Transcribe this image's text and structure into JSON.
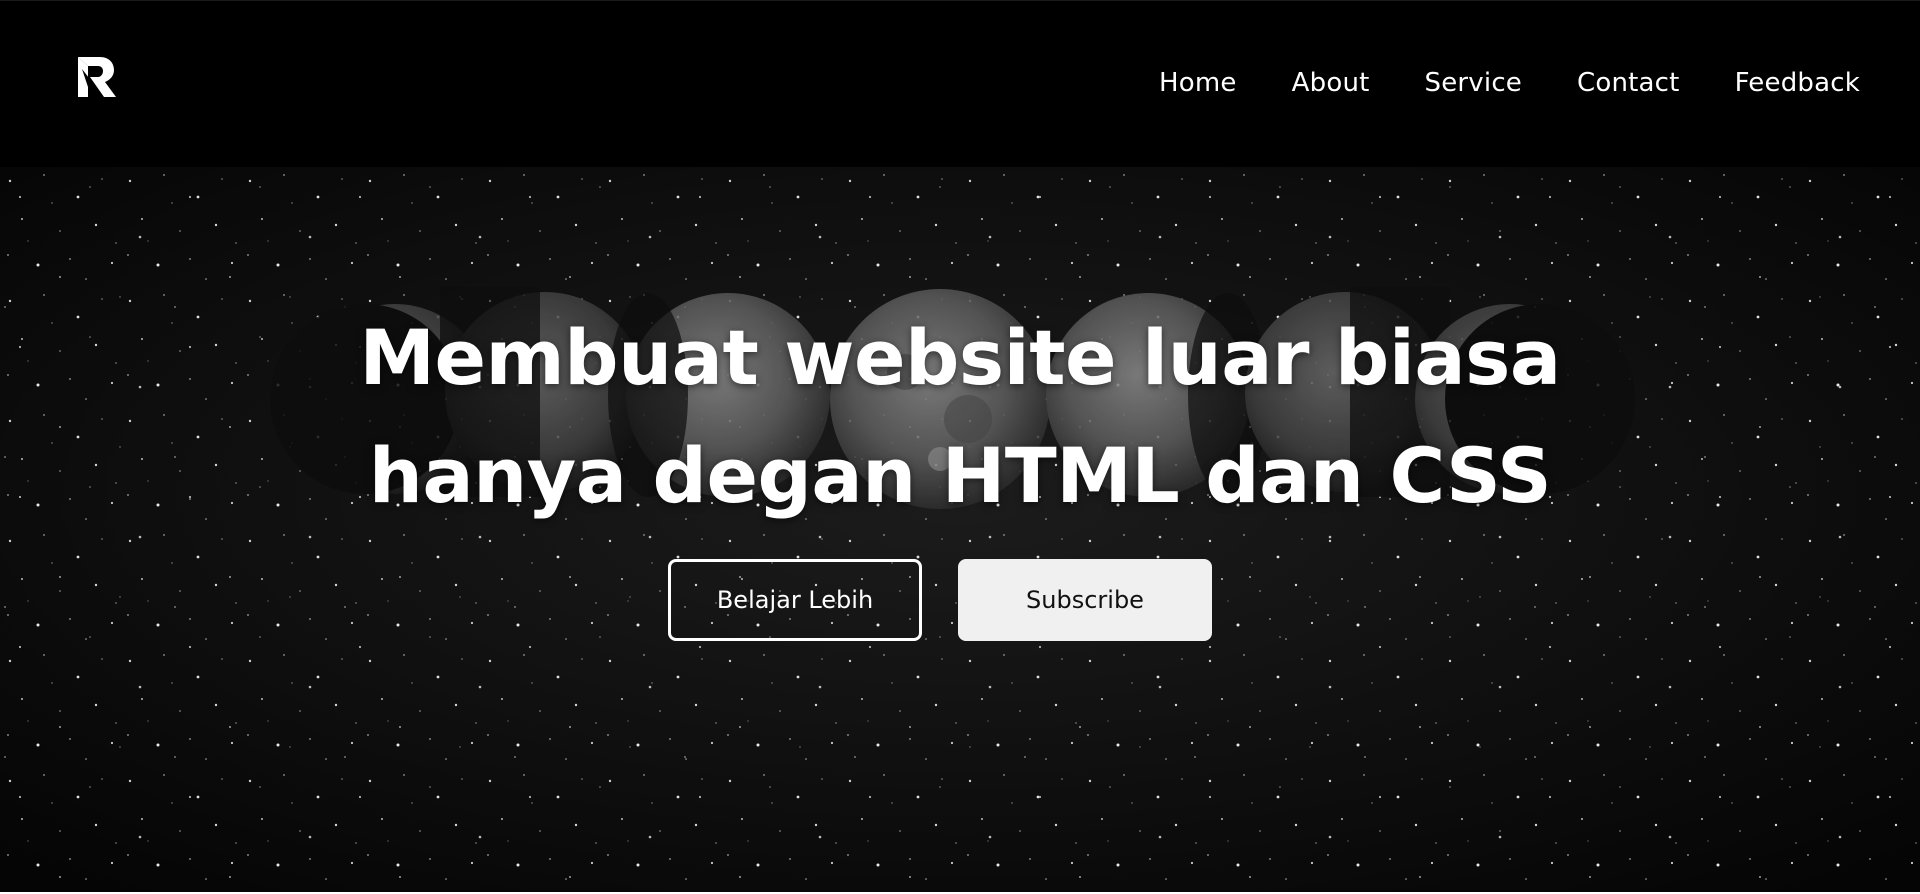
{
  "colors": {
    "navbar_bg": "#000000",
    "hero_bg": "#0a0a0a",
    "text": "#ffffff",
    "button_solid_bg": "#f0f0f0",
    "button_solid_text": "#111111"
  },
  "logo": {
    "icon": "r-logo-icon"
  },
  "nav": {
    "items": [
      {
        "label": "Home"
      },
      {
        "label": "About"
      },
      {
        "label": "Service"
      },
      {
        "label": "Contact"
      },
      {
        "label": "Feedback"
      }
    ]
  },
  "hero": {
    "background": "moon-phases-starfield",
    "title_line1": "Membuat website luar biasa",
    "title_line2": "hanya degan HTML dan CSS",
    "primary_button": "Belajar Lebih",
    "secondary_button": "Subscribe"
  }
}
